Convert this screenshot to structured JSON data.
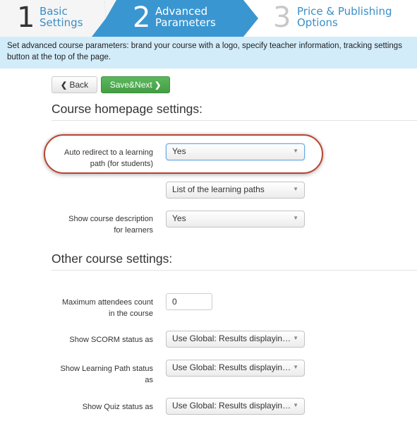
{
  "wizard": {
    "steps": [
      {
        "number": "1",
        "line1": "Basic",
        "line2": "Settings",
        "state": "completed"
      },
      {
        "number": "2",
        "line1": "Advanced",
        "line2": "Parameters",
        "state": "active"
      },
      {
        "number": "3",
        "line1": "Price & Publishing",
        "line2": "Options",
        "state": "upcoming"
      }
    ],
    "active_color": "#3a96d0"
  },
  "banner": {
    "line1": "Set advanced course parameters: brand your course with a logo, specify teacher information, tracking settings",
    "line2": "button at the top of the page."
  },
  "toolbar": {
    "back_label": "Back",
    "save_next_label": "Save&Next"
  },
  "homepage_section": {
    "title": "Course homepage settings:",
    "fields": [
      {
        "label_line1": "Auto redirect to a learning",
        "label_line2": "path (for students)",
        "value": "Yes",
        "highlighted": true
      },
      {
        "label_line1": "",
        "label_line2": "",
        "value": "List of the learning paths"
      },
      {
        "label_line1": "Show course description",
        "label_line2": "for learners",
        "value": "Yes"
      }
    ]
  },
  "other_section": {
    "title": "Other course settings:",
    "fields": [
      {
        "label_line1": "Maximum attendees count",
        "label_line2": "in the course",
        "value": "0",
        "type": "number"
      },
      {
        "label_line1": "Show SCORM status as",
        "label_line2": "",
        "value": "Use Global: Results displayin…"
      },
      {
        "label_line1": "Show Learning Path status",
        "label_line2": "as",
        "value": "Use Global: Results displayin…"
      },
      {
        "label_line1": "Show Quiz status as",
        "label_line2": "",
        "value": "Use Global: Results displayin…"
      }
    ]
  },
  "icons": {
    "back": "chevron-left-icon",
    "next": "chevron-right-icon",
    "dropdown": "caret-down-icon"
  },
  "glyphs": {
    "chevron_left": "❮",
    "chevron_right": "❯",
    "caret_down": "▼"
  }
}
